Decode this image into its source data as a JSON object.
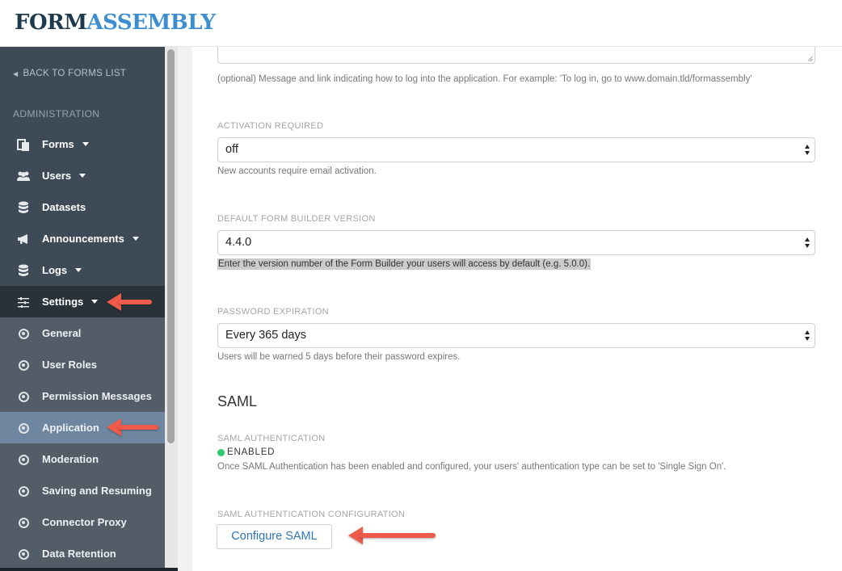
{
  "app": {
    "logo_part1": "FORM",
    "logo_part2": "ASSEMBLY"
  },
  "sidebar": {
    "back_label": "BACK TO FORMS LIST",
    "section_title": "ADMINISTRATION",
    "items": [
      {
        "label": "Forms",
        "icon": "forms-icon",
        "dropdown": true
      },
      {
        "label": "Users",
        "icon": "users-icon",
        "dropdown": true
      },
      {
        "label": "Datasets",
        "icon": "database-icon",
        "dropdown": false
      },
      {
        "label": "Announcements",
        "icon": "megaphone-icon",
        "dropdown": true
      },
      {
        "label": "Logs",
        "icon": "database-icon",
        "dropdown": true
      },
      {
        "label": "Settings",
        "icon": "sliders-icon",
        "dropdown": true,
        "active": true
      }
    ],
    "subitems": [
      {
        "label": "General"
      },
      {
        "label": "User Roles"
      },
      {
        "label": "Permission Messages"
      },
      {
        "label": "Application",
        "selected": true
      },
      {
        "label": "Moderation"
      },
      {
        "label": "Saving and Resuming"
      },
      {
        "label": "Connector Proxy"
      },
      {
        "label": "Data Retention"
      }
    ]
  },
  "main": {
    "login_help": "(optional) Message and link indicating how to log into the application. For example: 'To log in, go to www.domain.tld/formassembly'",
    "activation": {
      "label": "ACTIVATION REQUIRED",
      "value": "off",
      "help": "New accounts require email activation."
    },
    "builder_version": {
      "label": "DEFAULT FORM BUILDER VERSION",
      "value": "4.4.0",
      "help": "Enter the version number of the Form Builder your users will access by default (e.g. 5.0.0)."
    },
    "password_expiration": {
      "label": "PASSWORD EXPIRATION",
      "value": "Every 365 days",
      "help": "Users will be warned 5 days before their password expires."
    },
    "saml_heading": "SAML",
    "saml_auth": {
      "label": "SAML AUTHENTICATION",
      "status": "ENABLED",
      "status_color": "#2ecc71",
      "help": "Once SAML Authentication has been enabled and configured, your users' authentication type can be set to 'Single Sign On'."
    },
    "saml_config": {
      "label": "SAML AUTHENTICATION CONFIGURATION",
      "button": "Configure SAML"
    }
  },
  "colors": {
    "sidebar_bg": "#3e4a55",
    "sidebar_active": "#2a3239",
    "sidebar_selected": "#6e86a0",
    "annotation_arrow": "#ee5b4a",
    "link_blue": "#2f76b5"
  }
}
